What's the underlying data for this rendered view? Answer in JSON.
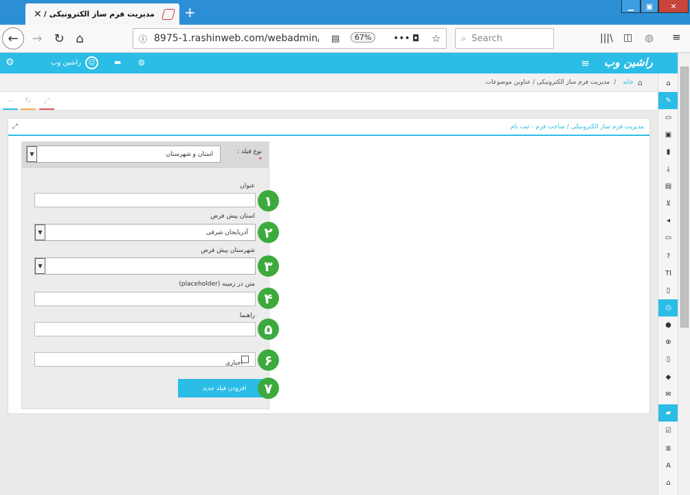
{
  "browser": {
    "tab_title": "مدیریت فرم ساز الکترونیکی / عناوی",
    "url": "8975-1.rashinweb.com/webadmin/",
    "zoom": "67%",
    "search_placeholder": "Search"
  },
  "header": {
    "logo": "راشین وب",
    "user_name": "راشین وب"
  },
  "breadcrumb": {
    "home": "خانه",
    "sep": "/",
    "item1": "مدیریت فرم ساز الکترونیکی / عناوین موضوعات"
  },
  "panel": {
    "title": "مدیریت فرم ساز الکترونیکی / ساخت فرم - ثبت نام"
  },
  "form": {
    "field_type_label": "نوع فیلد :",
    "required_star": "*",
    "field_type_value": "استان و شهرستان",
    "title_label": "عنوان",
    "default_province_label": "استان پیش فرض",
    "default_province_value": "آذربایجان شرقی",
    "default_city_label": "شهرستان پیش فرض",
    "placeholder_label": "متن در زمینه (placeholder)",
    "guide_label": "راهنما",
    "required_label": "اجباری",
    "add_button": "افزودن فیلد جدید",
    "markers": [
      "۱",
      "۲",
      "۳",
      "۴",
      "۵",
      "۶",
      "۷"
    ]
  },
  "colors": {
    "accent": "#2bbde6",
    "marker": "#3caa3c",
    "titlebar": "#2c8fd5"
  }
}
